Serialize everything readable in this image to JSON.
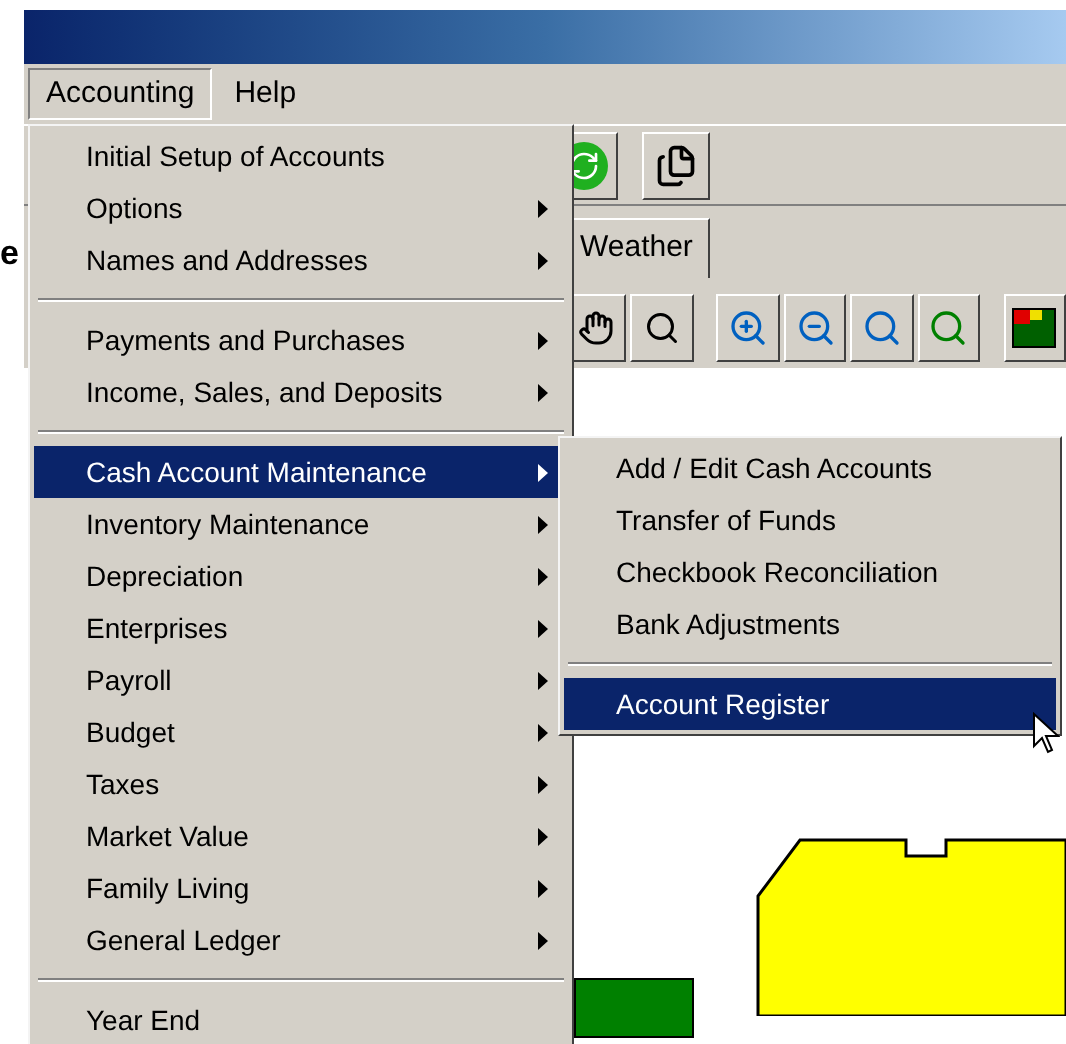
{
  "edge_text": "e",
  "menubar": [
    {
      "label": "Accounting",
      "selected": true
    },
    {
      "label": "Help",
      "selected": false
    }
  ],
  "tabs": [
    {
      "label": "Weather",
      "selected": false
    }
  ],
  "menu": [
    {
      "kind": "item",
      "label": "Initial Setup of Accounts",
      "submenu": false,
      "selected": false
    },
    {
      "kind": "item",
      "label": "Options",
      "submenu": true,
      "selected": false
    },
    {
      "kind": "item",
      "label": "Names and Addresses",
      "submenu": true,
      "selected": false
    },
    {
      "kind": "separator"
    },
    {
      "kind": "item",
      "label": "Payments and Purchases",
      "submenu": true,
      "selected": false
    },
    {
      "kind": "item",
      "label": "Income, Sales, and Deposits",
      "submenu": true,
      "selected": false
    },
    {
      "kind": "separator"
    },
    {
      "kind": "item",
      "label": "Cash Account Maintenance",
      "submenu": true,
      "selected": true
    },
    {
      "kind": "item",
      "label": "Inventory Maintenance",
      "submenu": true,
      "selected": false
    },
    {
      "kind": "item",
      "label": "Depreciation",
      "submenu": true,
      "selected": false
    },
    {
      "kind": "item",
      "label": "Enterprises",
      "submenu": true,
      "selected": false
    },
    {
      "kind": "item",
      "label": "Payroll",
      "submenu": true,
      "selected": false
    },
    {
      "kind": "item",
      "label": "Budget",
      "submenu": true,
      "selected": false
    },
    {
      "kind": "item",
      "label": "Taxes",
      "submenu": true,
      "selected": false
    },
    {
      "kind": "item",
      "label": "Market Value",
      "submenu": true,
      "selected": false
    },
    {
      "kind": "item",
      "label": "Family Living",
      "submenu": true,
      "selected": false
    },
    {
      "kind": "item",
      "label": "General Ledger",
      "submenu": true,
      "selected": false
    },
    {
      "kind": "separator"
    },
    {
      "kind": "item",
      "label": "Year End",
      "submenu": false,
      "selected": false
    }
  ],
  "submenu": [
    {
      "kind": "item",
      "label": "Add / Edit Cash Accounts",
      "submenu": false,
      "selected": false
    },
    {
      "kind": "item",
      "label": "Transfer of Funds",
      "submenu": false,
      "selected": false
    },
    {
      "kind": "item",
      "label": "Checkbook Reconciliation",
      "submenu": false,
      "selected": false
    },
    {
      "kind": "item",
      "label": "Bank Adjustments",
      "submenu": false,
      "selected": false
    },
    {
      "kind": "separator"
    },
    {
      "kind": "item",
      "label": "Account Register",
      "submenu": false,
      "selected": true
    }
  ]
}
